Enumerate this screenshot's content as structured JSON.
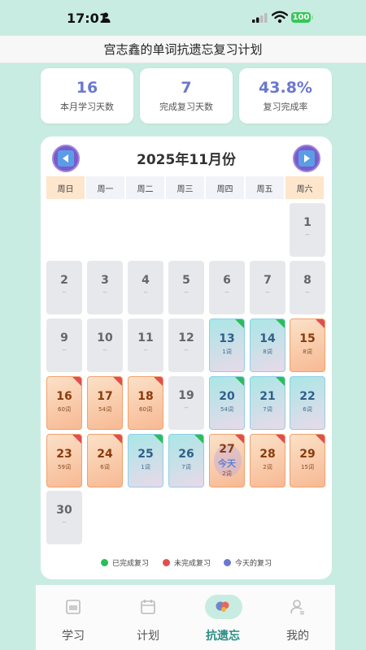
{
  "status_bar": {
    "time": "17:01",
    "battery": "100"
  },
  "header": {
    "title": "宫志鑫的单词抗遗忘复习计划"
  },
  "stats": [
    {
      "value": "16",
      "label": "本月学习天数"
    },
    {
      "value": "7",
      "label": "完成复习天数"
    },
    {
      "value": "43.8%",
      "label": "复习完成率"
    }
  ],
  "calendar": {
    "title": "2025年11月份",
    "weekdays": [
      "周日",
      "周一",
      "周二",
      "周三",
      "周四",
      "周五",
      "周六"
    ],
    "days": [
      {
        "day": "1",
        "sub": "--"
      },
      {
        "day": "2",
        "sub": "--"
      },
      {
        "day": "3",
        "sub": "--"
      },
      {
        "day": "4",
        "sub": "--"
      },
      {
        "day": "5",
        "sub": "--"
      },
      {
        "day": "6",
        "sub": "--"
      },
      {
        "day": "7",
        "sub": "--"
      },
      {
        "day": "8",
        "sub": "--"
      },
      {
        "day": "9",
        "sub": "--"
      },
      {
        "day": "10",
        "sub": "--"
      },
      {
        "day": "11",
        "sub": "--"
      },
      {
        "day": "12",
        "sub": "--"
      },
      {
        "day": "13",
        "sub": "1词"
      },
      {
        "day": "14",
        "sub": "8词"
      },
      {
        "day": "15",
        "sub": "8词"
      },
      {
        "day": "16",
        "sub": "60词"
      },
      {
        "day": "17",
        "sub": "54词"
      },
      {
        "day": "18",
        "sub": "60词"
      },
      {
        "day": "19",
        "sub": "--"
      },
      {
        "day": "20",
        "sub": "54词"
      },
      {
        "day": "21",
        "sub": "7词"
      },
      {
        "day": "22",
        "sub": "6词"
      },
      {
        "day": "23",
        "sub": "59词"
      },
      {
        "day": "24",
        "sub": "6词"
      },
      {
        "day": "25",
        "sub": "1词"
      },
      {
        "day": "26",
        "sub": "7词"
      },
      {
        "day": "27",
        "sub": "2词",
        "today_label": "今天"
      },
      {
        "day": "28",
        "sub": "2词"
      },
      {
        "day": "29",
        "sub": "15词"
      },
      {
        "day": "30",
        "sub": "--"
      }
    ]
  },
  "legend": [
    {
      "label": "已完成复习",
      "color": "#2bbd5a"
    },
    {
      "label": "未完成复习",
      "color": "#e24d4d"
    },
    {
      "label": "今天的复习",
      "color": "#6a78cf"
    }
  ],
  "tabs": [
    {
      "label": "学习",
      "icon": "book-icon"
    },
    {
      "label": "计划",
      "icon": "calendar-icon"
    },
    {
      "label": "抗遗忘",
      "icon": "brain-icon"
    },
    {
      "label": "我的",
      "icon": "user-icon"
    }
  ]
}
